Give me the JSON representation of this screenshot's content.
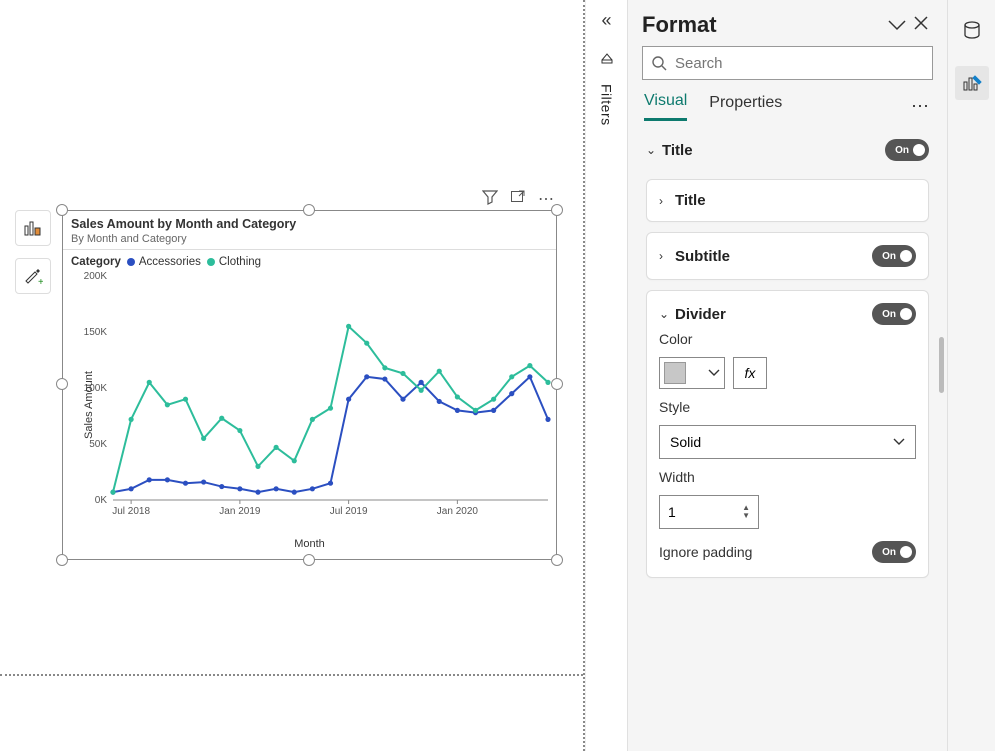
{
  "format_panel": {
    "title": "Format",
    "search_placeholder": "Search",
    "tabs": {
      "visual": "Visual",
      "properties": "Properties"
    },
    "sections": {
      "title_head": "Title",
      "title_sub": "Title",
      "subtitle": "Subtitle",
      "divider": "Divider",
      "color": "Color",
      "style": "Style",
      "style_value": "Solid",
      "width": "Width",
      "width_value": "1",
      "ignore_padding": "Ignore padding",
      "fx": "fx"
    },
    "toggle_on": "On"
  },
  "filters_label": "Filters",
  "visual": {
    "title": "Sales Amount by Month and Category",
    "subtitle": "By Month and Category",
    "legend_title": "Category",
    "x_label": "Month",
    "y_label": "Sales Amount"
  },
  "chart_data": {
    "type": "line",
    "xlabel": "Month",
    "ylabel": "Sales Amount",
    "ylim": [
      0,
      200000
    ],
    "y_ticks": [
      "0K",
      "50K",
      "100K",
      "150K",
      "200K"
    ],
    "x_tick_labels": [
      "Jul 2018",
      "Jan 2019",
      "Jul 2019",
      "Jan 2020"
    ],
    "categories": [
      "2018-06",
      "2018-07",
      "2018-08",
      "2018-09",
      "2018-10",
      "2018-11",
      "2018-12",
      "2019-01",
      "2019-02",
      "2019-03",
      "2019-04",
      "2019-05",
      "2019-06",
      "2019-07",
      "2019-08",
      "2019-09",
      "2019-10",
      "2019-11",
      "2019-12",
      "2020-01",
      "2020-02",
      "2020-03",
      "2020-04",
      "2020-05",
      "2020-06"
    ],
    "series": [
      {
        "name": "Accessories",
        "color": "#2b4fc1",
        "values": [
          7000,
          10000,
          18000,
          18000,
          15000,
          16000,
          12000,
          10000,
          7000,
          10000,
          7000,
          10000,
          15000,
          90000,
          110000,
          108000,
          90000,
          105000,
          88000,
          80000,
          78000,
          80000,
          95000,
          110000,
          72000
        ]
      },
      {
        "name": "Clothing",
        "color": "#2dbd9b",
        "values": [
          7000,
          72000,
          105000,
          85000,
          90000,
          55000,
          73000,
          62000,
          30000,
          47000,
          35000,
          72000,
          82000,
          155000,
          140000,
          118000,
          113000,
          98000,
          115000,
          92000,
          80000,
          90000,
          110000,
          120000,
          105000
        ]
      }
    ]
  }
}
